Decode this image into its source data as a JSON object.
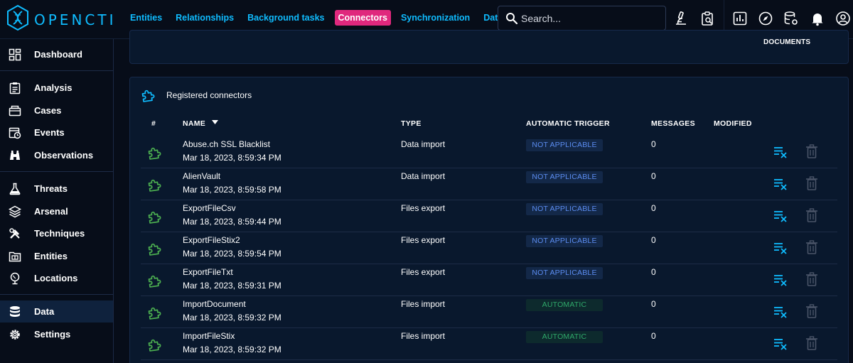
{
  "app": {
    "logo_text": "OPENCTI"
  },
  "nav": {
    "items": [
      {
        "label": "Entities",
        "active": false
      },
      {
        "label": "Relationships",
        "active": false
      },
      {
        "label": "Background tasks",
        "active": false
      },
      {
        "label": "Connectors",
        "active": true
      },
      {
        "label": "Synchronization",
        "active": false
      },
      {
        "label": "Data sharing",
        "active": false
      }
    ]
  },
  "search": {
    "placeholder": "Search..."
  },
  "sidebar": {
    "items": [
      {
        "label": "Dashboard",
        "icon": "dashboard-icon"
      },
      {
        "label": "Analysis",
        "icon": "analysis-icon"
      },
      {
        "label": "Cases",
        "icon": "cases-icon"
      },
      {
        "label": "Events",
        "icon": "events-icon"
      },
      {
        "label": "Observations",
        "icon": "observations-icon"
      },
      {
        "label": "Threats",
        "icon": "threats-icon"
      },
      {
        "label": "Arsenal",
        "icon": "arsenal-icon"
      },
      {
        "label": "Techniques",
        "icon": "techniques-icon"
      },
      {
        "label": "Entities",
        "icon": "entities-icon"
      },
      {
        "label": "Locations",
        "icon": "locations-icon"
      },
      {
        "label": "Data",
        "icon": "data-icon",
        "active": true
      },
      {
        "label": "Settings",
        "icon": "settings-icon"
      }
    ]
  },
  "top_card": {
    "documents_label": "DOCUMENTS"
  },
  "connectors": {
    "title": "Registered connectors",
    "columns": {
      "index": "#",
      "name": "NAME",
      "type": "TYPE",
      "trigger": "AUTOMATIC TRIGGER",
      "messages": "MESSAGES",
      "modified": "MODIFIED"
    },
    "rows": [
      {
        "name": "Abuse.ch SSL Blacklist",
        "date": "Mar 18, 2023, 8:59:34 PM",
        "type": "Data import",
        "trigger": "NOT APPLICABLE",
        "messages": "0"
      },
      {
        "name": "AlienVault",
        "date": "Mar 18, 2023, 8:59:58 PM",
        "type": "Data import",
        "trigger": "NOT APPLICABLE",
        "messages": "0"
      },
      {
        "name": "ExportFileCsv",
        "date": "Mar 18, 2023, 8:59:44 PM",
        "type": "Files export",
        "trigger": "NOT APPLICABLE",
        "messages": "0"
      },
      {
        "name": "ExportFileStix2",
        "date": "Mar 18, 2023, 8:59:54 PM",
        "type": "Files export",
        "trigger": "NOT APPLICABLE",
        "messages": "0"
      },
      {
        "name": "ExportFileTxt",
        "date": "Mar 18, 2023, 8:59:31 PM",
        "type": "Files export",
        "trigger": "NOT APPLICABLE",
        "messages": "0"
      },
      {
        "name": "ImportDocument",
        "date": "Mar 18, 2023, 8:59:32 PM",
        "type": "Files import",
        "trigger": "AUTOMATIC",
        "messages": "0"
      },
      {
        "name": "ImportFileStix",
        "date": "Mar 18, 2023, 8:59:32 PM",
        "type": "Files import",
        "trigger": "AUTOMATIC",
        "messages": "0"
      }
    ]
  },
  "colors": {
    "accent": "#0fbcff",
    "active_tab": "#e0287d",
    "connector_icon": "#4caf50",
    "not_applicable": "#5b8cf0",
    "automatic": "#2fa86a"
  }
}
